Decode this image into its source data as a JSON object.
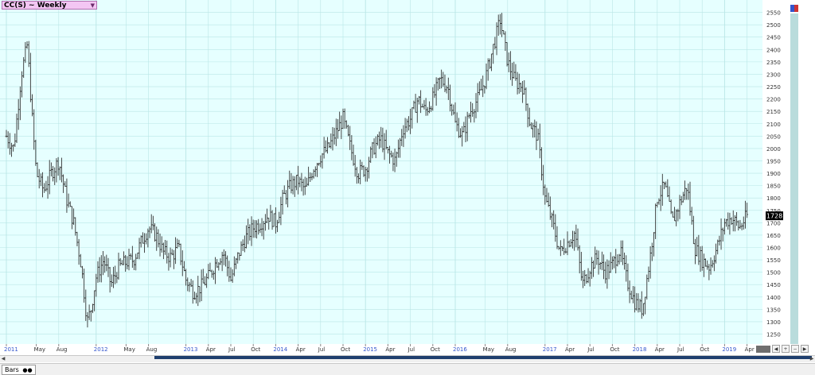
{
  "header": {
    "symbol_label": "CC(S) ~ Weekly",
    "dropdown_icon": "chevron-down-icon"
  },
  "colors": {
    "plot_bg": "#e6ffff",
    "grid": "#b9e6e6",
    "bars": "#333333",
    "axis_text": "#333333",
    "x_year_text": "#3355cc",
    "last_price_bg": "#000000",
    "last_price_text": "#ffffff",
    "scrollbar": "#1f3f6e",
    "right_strip": "#b9dcdc"
  },
  "price_badge": {
    "value": "1728"
  },
  "status": {
    "tab_label": "Bars",
    "tab_icon": "circles-icon"
  },
  "chart_data": {
    "type": "bar",
    "subtype": "ohlc",
    "title": "CC(S) ~ Weekly",
    "ylim": [
      1210,
      2600
    ],
    "yticks": [
      1250,
      1300,
      1350,
      1400,
      1450,
      1500,
      1550,
      1600,
      1650,
      1700,
      1750,
      1800,
      1850,
      1900,
      1950,
      2000,
      2050,
      2100,
      2150,
      2200,
      2250,
      2300,
      2350,
      2400,
      2450,
      2500,
      2550
    ],
    "x_start": "2011-01",
    "x_end": "2019-04",
    "xticks": [
      {
        "label": "2011",
        "m": 0,
        "year": true
      },
      {
        "label": "May",
        "m": 4
      },
      {
        "label": "Aug",
        "m": 7
      },
      {
        "label": "2012",
        "m": 12,
        "year": true
      },
      {
        "label": "May",
        "m": 16
      },
      {
        "label": "Aug",
        "m": 19
      },
      {
        "label": "2013",
        "m": 24,
        "year": true
      },
      {
        "label": "Apr",
        "m": 27
      },
      {
        "label": "Jul",
        "m": 30
      },
      {
        "label": "Oct",
        "m": 33
      },
      {
        "label": "2014",
        "m": 36,
        "year": true
      },
      {
        "label": "Apr",
        "m": 39
      },
      {
        "label": "Jul",
        "m": 42
      },
      {
        "label": "Oct",
        "m": 45
      },
      {
        "label": "2015",
        "m": 48,
        "year": true
      },
      {
        "label": "Apr",
        "m": 51
      },
      {
        "label": "Jul",
        "m": 54
      },
      {
        "label": "Oct",
        "m": 57
      },
      {
        "label": "2016",
        "m": 60,
        "year": true
      },
      {
        "label": "May",
        "m": 64
      },
      {
        "label": "Aug",
        "m": 67
      },
      {
        "label": "2017",
        "m": 72,
        "year": true
      },
      {
        "label": "Apr",
        "m": 75
      },
      {
        "label": "Jul",
        "m": 78
      },
      {
        "label": "Oct",
        "m": 81
      },
      {
        "label": "2018",
        "m": 84,
        "year": true
      },
      {
        "label": "Apr",
        "m": 87
      },
      {
        "label": "Jul",
        "m": 90
      },
      {
        "label": "Oct",
        "m": 93
      },
      {
        "label": "2019",
        "m": 96,
        "year": true
      },
      {
        "label": "Apr",
        "m": 99
      }
    ],
    "anchors_monthly_close": [
      [
        0,
        2050
      ],
      [
        1,
        2000
      ],
      [
        2,
        2300
      ],
      [
        2.8,
        2420
      ],
      [
        3.5,
        2100
      ],
      [
        4,
        1900
      ],
      [
        5,
        1830
      ],
      [
        6,
        1900
      ],
      [
        7,
        1950
      ],
      [
        8,
        1800
      ],
      [
        9,
        1700
      ],
      [
        10,
        1530
      ],
      [
        10.8,
        1300
      ],
      [
        11.3,
        1350
      ],
      [
        12,
        1480
      ],
      [
        13,
        1550
      ],
      [
        14,
        1450
      ],
      [
        15,
        1520
      ],
      [
        16,
        1540
      ],
      [
        17,
        1550
      ],
      [
        18,
        1620
      ],
      [
        19,
        1680
      ],
      [
        20,
        1650
      ],
      [
        21,
        1580
      ],
      [
        22,
        1560
      ],
      [
        23,
        1600
      ],
      [
        24,
        1470
      ],
      [
        25,
        1420
      ],
      [
        26,
        1440
      ],
      [
        27,
        1480
      ],
      [
        28,
        1540
      ],
      [
        29,
        1580
      ],
      [
        30,
        1470
      ],
      [
        31,
        1570
      ],
      [
        32,
        1640
      ],
      [
        33,
        1680
      ],
      [
        34,
        1700
      ],
      [
        35,
        1730
      ],
      [
        36,
        1700
      ],
      [
        37,
        1800
      ],
      [
        38,
        1850
      ],
      [
        39,
        1870
      ],
      [
        40,
        1830
      ],
      [
        41,
        1920
      ],
      [
        42,
        1970
      ],
      [
        43,
        2000
      ],
      [
        44,
        2060
      ],
      [
        45,
        2120
      ],
      [
        46,
        2000
      ],
      [
        47,
        1900
      ],
      [
        48,
        1920
      ],
      [
        49,
        2000
      ],
      [
        50,
        2040
      ],
      [
        51,
        1980
      ],
      [
        52,
        1950
      ],
      [
        53,
        2080
      ],
      [
        54,
        2120
      ],
      [
        55,
        2200
      ],
      [
        56,
        2150
      ],
      [
        57,
        2200
      ],
      [
        58,
        2280
      ],
      [
        59,
        2250
      ],
      [
        60,
        2100
      ],
      [
        61,
        2050
      ],
      [
        62,
        2150
      ],
      [
        63,
        2200
      ],
      [
        64,
        2280
      ],
      [
        65,
        2400
      ],
      [
        66,
        2520
      ],
      [
        67,
        2350
      ],
      [
        68,
        2270
      ],
      [
        69,
        2250
      ],
      [
        70,
        2100
      ],
      [
        71,
        2050
      ],
      [
        72,
        1800
      ],
      [
        73,
        1700
      ],
      [
        74,
        1580
      ],
      [
        75,
        1620
      ],
      [
        76,
        1660
      ],
      [
        77,
        1450
      ],
      [
        78,
        1520
      ],
      [
        79,
        1560
      ],
      [
        80,
        1500
      ],
      [
        81,
        1530
      ],
      [
        82,
        1590
      ],
      [
        83,
        1460
      ],
      [
        84,
        1380
      ],
      [
        85,
        1350
      ],
      [
        86,
        1550
      ],
      [
        87,
        1800
      ],
      [
        88,
        1850
      ],
      [
        89,
        1700
      ],
      [
        90,
        1780
      ],
      [
        91,
        1850
      ],
      [
        92,
        1600
      ],
      [
        93,
        1550
      ],
      [
        94,
        1520
      ],
      [
        95,
        1600
      ],
      [
        96,
        1700
      ],
      [
        97,
        1720
      ],
      [
        98,
        1680
      ],
      [
        99,
        1728
      ]
    ],
    "last_value": 1728
  }
}
